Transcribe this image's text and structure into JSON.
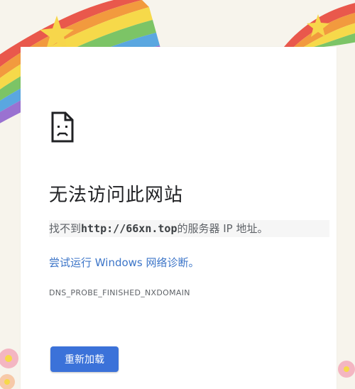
{
  "error_page": {
    "title": "无法访问此网站",
    "message_prefix": "找不到",
    "domain": "http://66xn.top",
    "message_suffix": "的服务器 IP 地址。",
    "diagnostics_link": "尝试运行 Windows 网络诊断。",
    "error_code": "DNS_PROBE_FINISHED_NXDOMAIN",
    "reload_label": "重新加载",
    "icon": "sad-page-icon"
  },
  "colors": {
    "accent": "#3b72d9",
    "link": "#3c75c8",
    "text": "#202124",
    "muted": "#5f6368"
  }
}
